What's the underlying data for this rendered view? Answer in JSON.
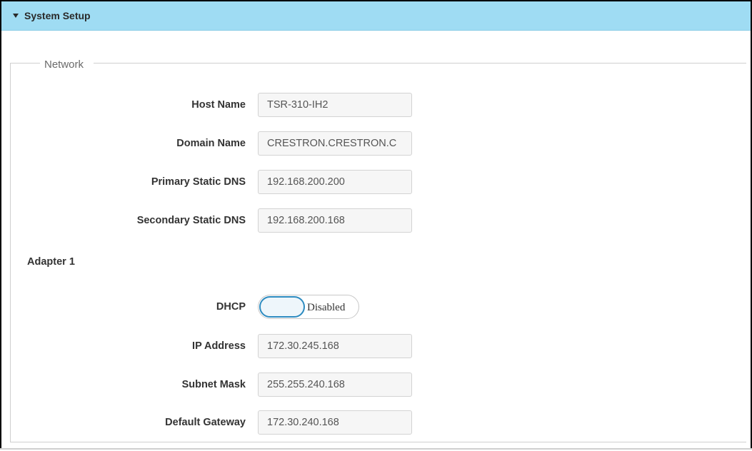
{
  "header": {
    "title": "System Setup"
  },
  "network": {
    "legend": "Network",
    "fields": [
      {
        "label": "Host Name",
        "value": "TSR-310-IH2"
      },
      {
        "label": "Domain Name",
        "value": "CRESTRON.CRESTRON.C"
      },
      {
        "label": "Primary Static DNS",
        "value": "192.168.200.200"
      },
      {
        "label": "Secondary Static DNS",
        "value": "192.168.200.168"
      }
    ]
  },
  "adapter": {
    "title": "Adapter 1",
    "dhcp": {
      "label": "DHCP",
      "state": "Disabled"
    },
    "fields": [
      {
        "label": "IP Address",
        "value": "172.30.245.168"
      },
      {
        "label": "Subnet Mask",
        "value": "255.255.240.168"
      },
      {
        "label": "Default Gateway",
        "value": "172.30.240.168"
      }
    ]
  }
}
